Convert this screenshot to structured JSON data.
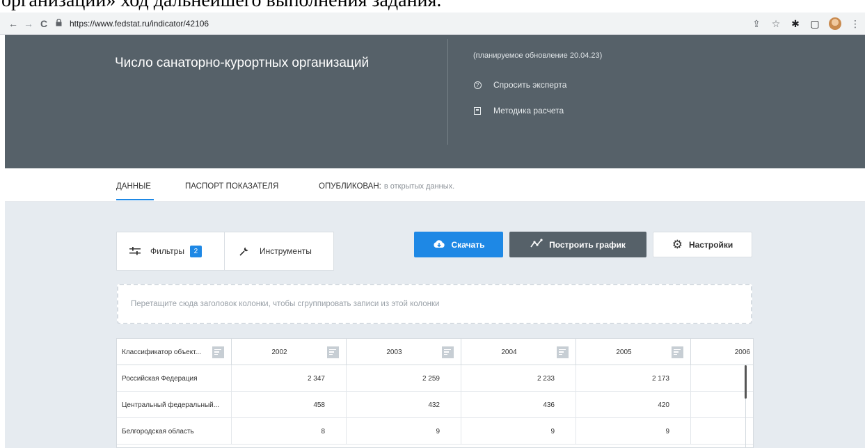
{
  "document": {
    "cut_text": "организаций» ход дальнейшего выполнения задания."
  },
  "browser": {
    "back_icon": "←",
    "forward_icon": "→",
    "reload_icon": "C",
    "lock_icon": "🔒",
    "url": "https://www.fedstat.ru/indicator/42106",
    "icons": [
      "share-icon",
      "star-icon",
      "extensions-icon",
      "sidebar-icon",
      "avatar",
      "menu-icon"
    ]
  },
  "banner": {
    "title": "Число санаторно-курортных организаций",
    "update_note": "(планируемое обновление 20.04.23)",
    "ask_expert": "Спросить эксперта",
    "methodology": "Методика расчета"
  },
  "tabs": {
    "data": "ДАННЫЕ",
    "passport": "ПАСПОРТ ПОКАЗАТЕЛЯ",
    "published_label": "ОПУБЛИКОВАН:",
    "published_value": "в открытых данных."
  },
  "toolbar": {
    "filters_label": "Фильтры",
    "filters_count": "2",
    "tools_label": "Инструменты",
    "download_label": "Скачать",
    "chart_label": "Построить график",
    "settings_label": "Настройки"
  },
  "dropzone": {
    "text": "Перетащите сюда заголовок колонки, чтобы сгруппировать записи из этой колонки"
  },
  "table": {
    "columns": [
      "Классификатор объект...",
      "2002",
      "2003",
      "2004",
      "2005",
      "2006"
    ],
    "rows": [
      {
        "name": "Российская Федерация",
        "values": [
          "2 347",
          "2 259",
          "2 233",
          "2 173",
          ""
        ]
      },
      {
        "name": "Центральный федеральный...",
        "values": [
          "458",
          "432",
          "436",
          "420",
          ""
        ]
      },
      {
        "name": "Белгородская область",
        "values": [
          "8",
          "9",
          "9",
          "9",
          ""
        ]
      }
    ]
  }
}
